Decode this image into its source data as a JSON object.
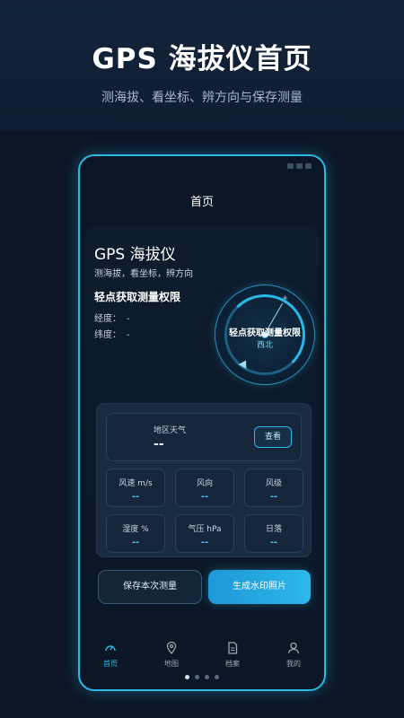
{
  "hero": {
    "title": "GPS 海拔仪首页",
    "subtitle": "测海拔、看坐标、辨方向与保存测量"
  },
  "nav": {
    "title": "首页"
  },
  "app": {
    "title": "GPS 海拔仪",
    "subtitle": "测海拔，看坐标，辨方向",
    "permission_label": "轻点获取测量权限",
    "latitude_label": "经度：",
    "latitude_value": "-",
    "longitude_label": "纬度：",
    "longitude_value": "-"
  },
  "compass": {
    "prompt": "轻点获取测量权限",
    "direction": "西北"
  },
  "weather": {
    "label": "地区天气",
    "value": "--",
    "view_button": "查看",
    "cells": [
      {
        "label": "风速 m/s",
        "value": "--"
      },
      {
        "label": "风向",
        "value": "--"
      },
      {
        "label": "风级",
        "value": "--"
      },
      {
        "label": "湿度 %",
        "value": "--"
      },
      {
        "label": "气压 hPa",
        "value": "--"
      },
      {
        "label": "日落",
        "value": "--"
      }
    ]
  },
  "actions": {
    "save": "保存本次测量",
    "watermark": "生成水印照片"
  },
  "tabs": [
    {
      "label": "首页"
    },
    {
      "label": "地图"
    },
    {
      "label": "档案"
    },
    {
      "label": "我的"
    }
  ],
  "colors": {
    "accent": "#2bb8e4",
    "background": "#0c1626"
  }
}
